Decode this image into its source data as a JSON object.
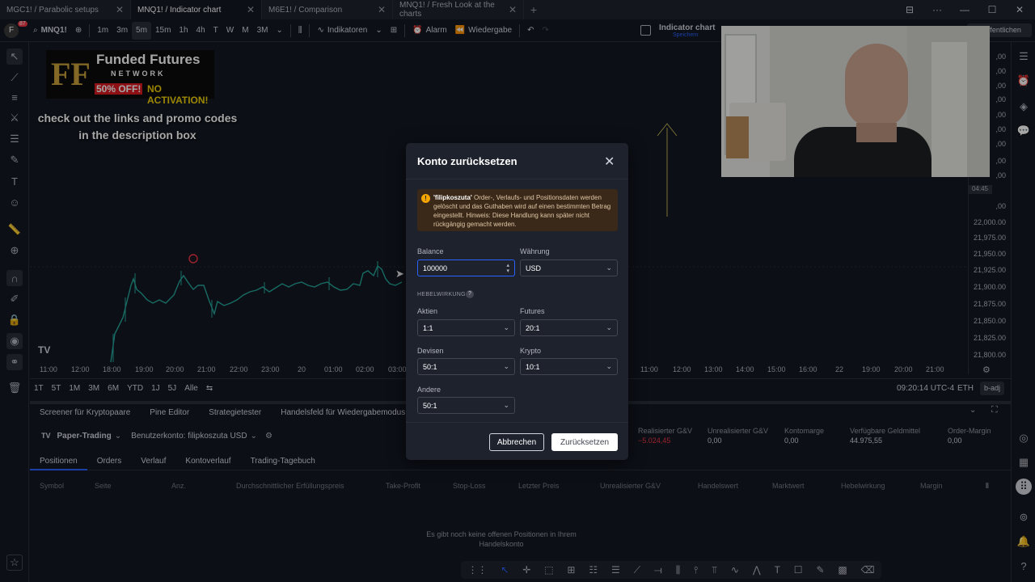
{
  "tabs": [
    {
      "label": "MGC1! / Parabolic setups"
    },
    {
      "label": "MNQ1! / Indicator chart"
    },
    {
      "label": "M6E1! / Comparison"
    },
    {
      "label": "MNQ1! / Fresh Look at the charts"
    }
  ],
  "toolbar": {
    "symbol": "MNQ1!",
    "intervals": [
      "1m",
      "3m",
      "5m",
      "15m",
      "1h",
      "4h",
      "T",
      "W",
      "M",
      "3M"
    ],
    "active_interval": "5m",
    "indicators": "Indikatoren",
    "alert": "Alarm",
    "replay": "Wiedergabe",
    "layout_name": "Indicator chart",
    "layout_sub": "Speichern",
    "publish": "ffentlichen",
    "badge_count": "87"
  },
  "promo": {
    "logo_line1": "Funded Futures",
    "logo_line2": "NETWORK",
    "logo_line3": "50% OFF! NO ACTIVATION!",
    "text_line1": "check out the links and promo codes",
    "text_line2": "in the description box"
  },
  "price_axis": [
    "22,000.00",
    "21,975.00",
    "21,950.00",
    "21,925.00",
    "21,900.00",
    "21,875.00",
    "21,850.00",
    "21,825.00",
    "21,800.00"
  ],
  "price_tag": "04:45",
  "time_axis": [
    "11:00",
    "12:00",
    "18:00",
    "19:00",
    "20:00",
    "21:00",
    "22:00",
    "23:00",
    "20",
    "01:00",
    "02:00",
    "03:00",
    "11:00",
    "12:00",
    "13:00",
    "14:00",
    "15:00",
    "16:00",
    "22",
    "19:00",
    "20:00",
    "21:00"
  ],
  "range_buttons": [
    "1T",
    "5T",
    "1M",
    "3M",
    "6M",
    "YTD",
    "1J",
    "5J",
    "Alle"
  ],
  "status": {
    "time": "09:20:14 UTC-4",
    "session": "ETH",
    "adj": "b-adj"
  },
  "panel_tabs": [
    "Screener für Kryptopaare",
    "Pine Editor",
    "Strategietester",
    "Handelsfeld für Wiedergabemodus"
  ],
  "broker": {
    "name": "Paper-Trading",
    "account": "Benutzerkonto: filipkoszuta USD",
    "stats": [
      {
        "label": "Realisierter G&V",
        "value": "−5.024,45",
        "color": "#f23645"
      },
      {
        "label": "Unrealisierter G&V",
        "value": "0,00",
        "color": "#d1d4dc"
      },
      {
        "label": "Kontomarge",
        "value": "0,00",
        "color": "#d1d4dc"
      },
      {
        "label": "Verfügbare Geldmittel",
        "value": "44.975,55",
        "color": "#d1d4dc"
      },
      {
        "label": "Order-Margin",
        "value": "0,00",
        "color": "#d1d4dc"
      }
    ]
  },
  "sub_tabs": [
    "Positionen",
    "Orders",
    "Verlauf",
    "Kontoverlauf",
    "Trading-Tagebuch"
  ],
  "columns": [
    "Symbol",
    "Seite",
    "Anz.",
    "Durchschnittlicher Erfüllungspreis",
    "Take-Profit",
    "Stop-Loss",
    "Letzter Preis",
    "Unrealisierter G&V",
    "Handelswert",
    "Marktwert",
    "Hebelwirkung",
    "Margin"
  ],
  "empty_message_1": "Es gibt noch keine offenen Positionen in Ihrem",
  "empty_message_2": "Handelskonto",
  "dialog": {
    "title": "Konto zurücksetzen",
    "warning_name": "'filipkoszuta'",
    "warning_text": " Order-, Verlaufs- und Positionsdaten werden gelöscht und das Guthaben wird auf einen bestimmten Betrag eingestellt. Hinweis: Diese Handlung kann später nicht rückgängig gemacht werden.",
    "balance_label": "Balance",
    "balance_value": "100000",
    "currency_label": "Währung",
    "currency_value": "USD",
    "leverage_title": "HEBELWIRKUNG",
    "stocks_label": "Aktien",
    "stocks_value": "1:1",
    "futures_label": "Futures",
    "futures_value": "20:1",
    "forex_label": "Devisen",
    "forex_value": "50:1",
    "crypto_label": "Krypto",
    "crypto_value": "10:1",
    "other_label": "Andere",
    "other_value": "50:1",
    "cancel": "Abbrechen",
    "reset": "Zurücksetzen"
  },
  "colors": {
    "accent": "#2962ff",
    "background": "#131722",
    "candle": "#26a69a",
    "warning": "#f7a600",
    "loss": "#f23645"
  }
}
